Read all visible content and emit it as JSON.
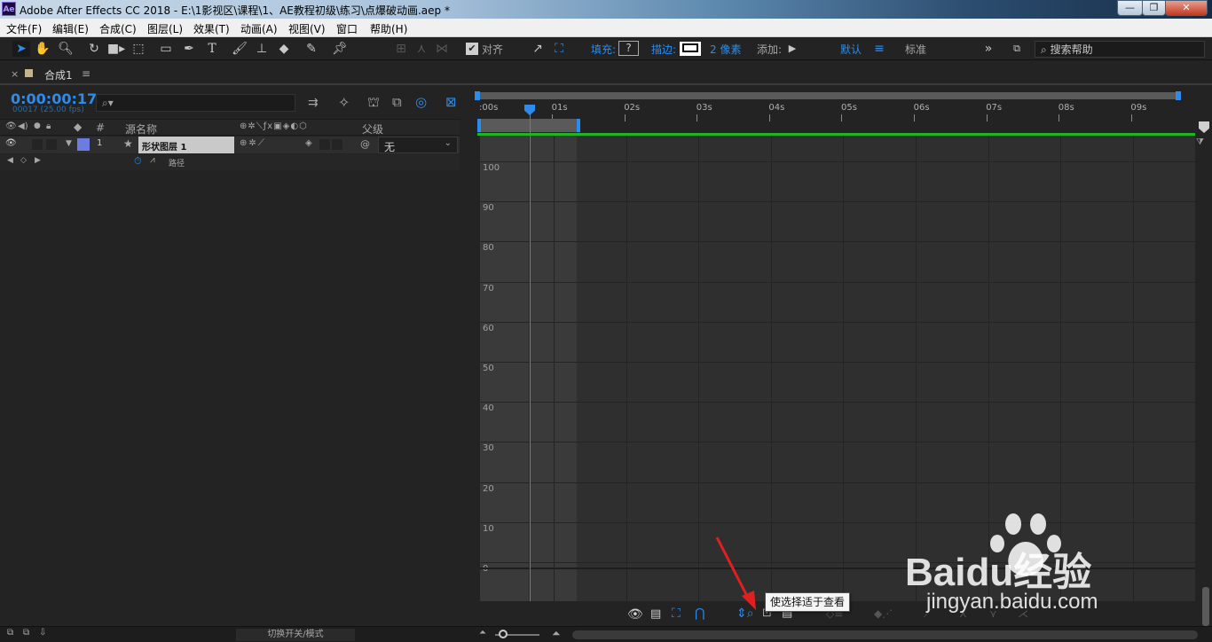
{
  "window": {
    "title": "Adobe After Effects CC 2018 - E:\\1影视区\\课程\\1、AE教程初级\\练习\\点爆破动画.aep *",
    "app_badge": "Ae"
  },
  "menu": [
    "文件(F)",
    "编辑(E)",
    "合成(C)",
    "图层(L)",
    "效果(T)",
    "动画(A)",
    "视图(V)",
    "窗口",
    "帮助(H)"
  ],
  "toolbar": {
    "snap_label": "对齐",
    "fill_label": "填充:",
    "fill_value": "?",
    "stroke_label": "描边:",
    "stroke_width": "2 像素",
    "add_label": "添加:",
    "workspace_default": "默认",
    "workspace_standard": "标准",
    "search_placeholder": "搜索帮助"
  },
  "panel": {
    "tab_label": "合成1",
    "menu_glyph": "≡",
    "close_glyph": "×"
  },
  "timeline": {
    "timecode": "0:00:00:17",
    "frame_info": "00017 (25.00 fps)",
    "search_glyph": "⌕▾",
    "columns": {
      "num": "#",
      "source_name": "源名称",
      "parent": "父级"
    },
    "layer": {
      "index": "1",
      "name": "形状图层 1",
      "parent_value": "无"
    },
    "property": {
      "name": "路径"
    },
    "ruler_labels": [
      ":00s",
      "01s",
      "02s",
      "03s",
      "04s",
      "05s",
      "06s",
      "07s",
      "08s",
      "09s"
    ],
    "y_labels": [
      "100",
      "90",
      "80",
      "70",
      "60",
      "50",
      "40",
      "30",
      "20",
      "10",
      "0"
    ],
    "current_time_seconds": 0.68
  },
  "tooltip": "使选择适于查看",
  "status": {
    "toggle_label": "切换开关/模式"
  },
  "watermark": {
    "text": "Baidu经验",
    "url": "jingyan.baidu.com"
  },
  "colors": {
    "accent": "#2d8ceb",
    "layer_label": "#6c7cdf",
    "work_area_green": "#21b421"
  }
}
